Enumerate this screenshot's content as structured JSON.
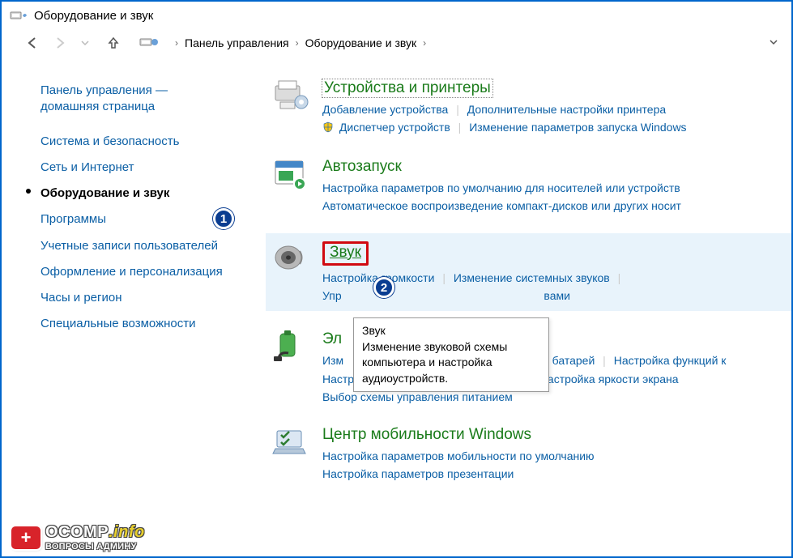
{
  "window": {
    "title": "Оборудование и звук"
  },
  "breadcrumbs": {
    "seg1": "Панель управления",
    "seg2": "Оборудование и звук"
  },
  "sidebar": {
    "items": [
      {
        "label": "Панель управления — домашняя страница"
      },
      {
        "label": "Система и безопасность"
      },
      {
        "label": "Сеть и Интернет"
      },
      {
        "label": "Оборудование и звук"
      },
      {
        "label": "Программы"
      },
      {
        "label": "Учетные записи пользователей"
      },
      {
        "label": "Оформление и персонализация"
      },
      {
        "label": "Часы и регион"
      },
      {
        "label": "Специальные возможности"
      }
    ]
  },
  "categories": {
    "devices": {
      "title": "Устройства и принтеры",
      "link1": "Добавление устройства",
      "link2": "Дополнительные настройки принтера",
      "link3": "Диспетчер устройств",
      "link4": "Изменение параметров запуска Windows"
    },
    "autoplay": {
      "title": "Автозапуск",
      "link1": "Настройка параметров по умолчанию для носителей или устройств",
      "link2": "Автоматическое воспроизведение компакт-дисков или других носит"
    },
    "sound": {
      "title": "Звук",
      "link1": "Настройка громкости",
      "link2": "Изменение системных звуков",
      "link3_a": "Упр",
      "link3_b": "вами"
    },
    "power": {
      "title": "Эл",
      "link1_a": "Изм",
      "link1_b": "от батарей",
      "link2": "Настройка функций к",
      "link3": "Настройка перехода в спящий режим",
      "link4": "Настройка яркости экрана",
      "link5": "Выбор схемы управления питанием"
    },
    "mobility": {
      "title": "Центр мобильности Windows",
      "link1": "Настройка параметров мобильности по умолчанию",
      "link2": "Настройка параметров презентации"
    }
  },
  "tooltip": {
    "title": "Звук",
    "body": "Изменение звуковой схемы компьютера и настройка аудиоустройств."
  },
  "badges": {
    "b1": "1",
    "b2": "2"
  },
  "watermark": {
    "brand": "OCOMP",
    "suffix": ".info",
    "tag": "ВОПРОСЫ АДМИНУ"
  }
}
